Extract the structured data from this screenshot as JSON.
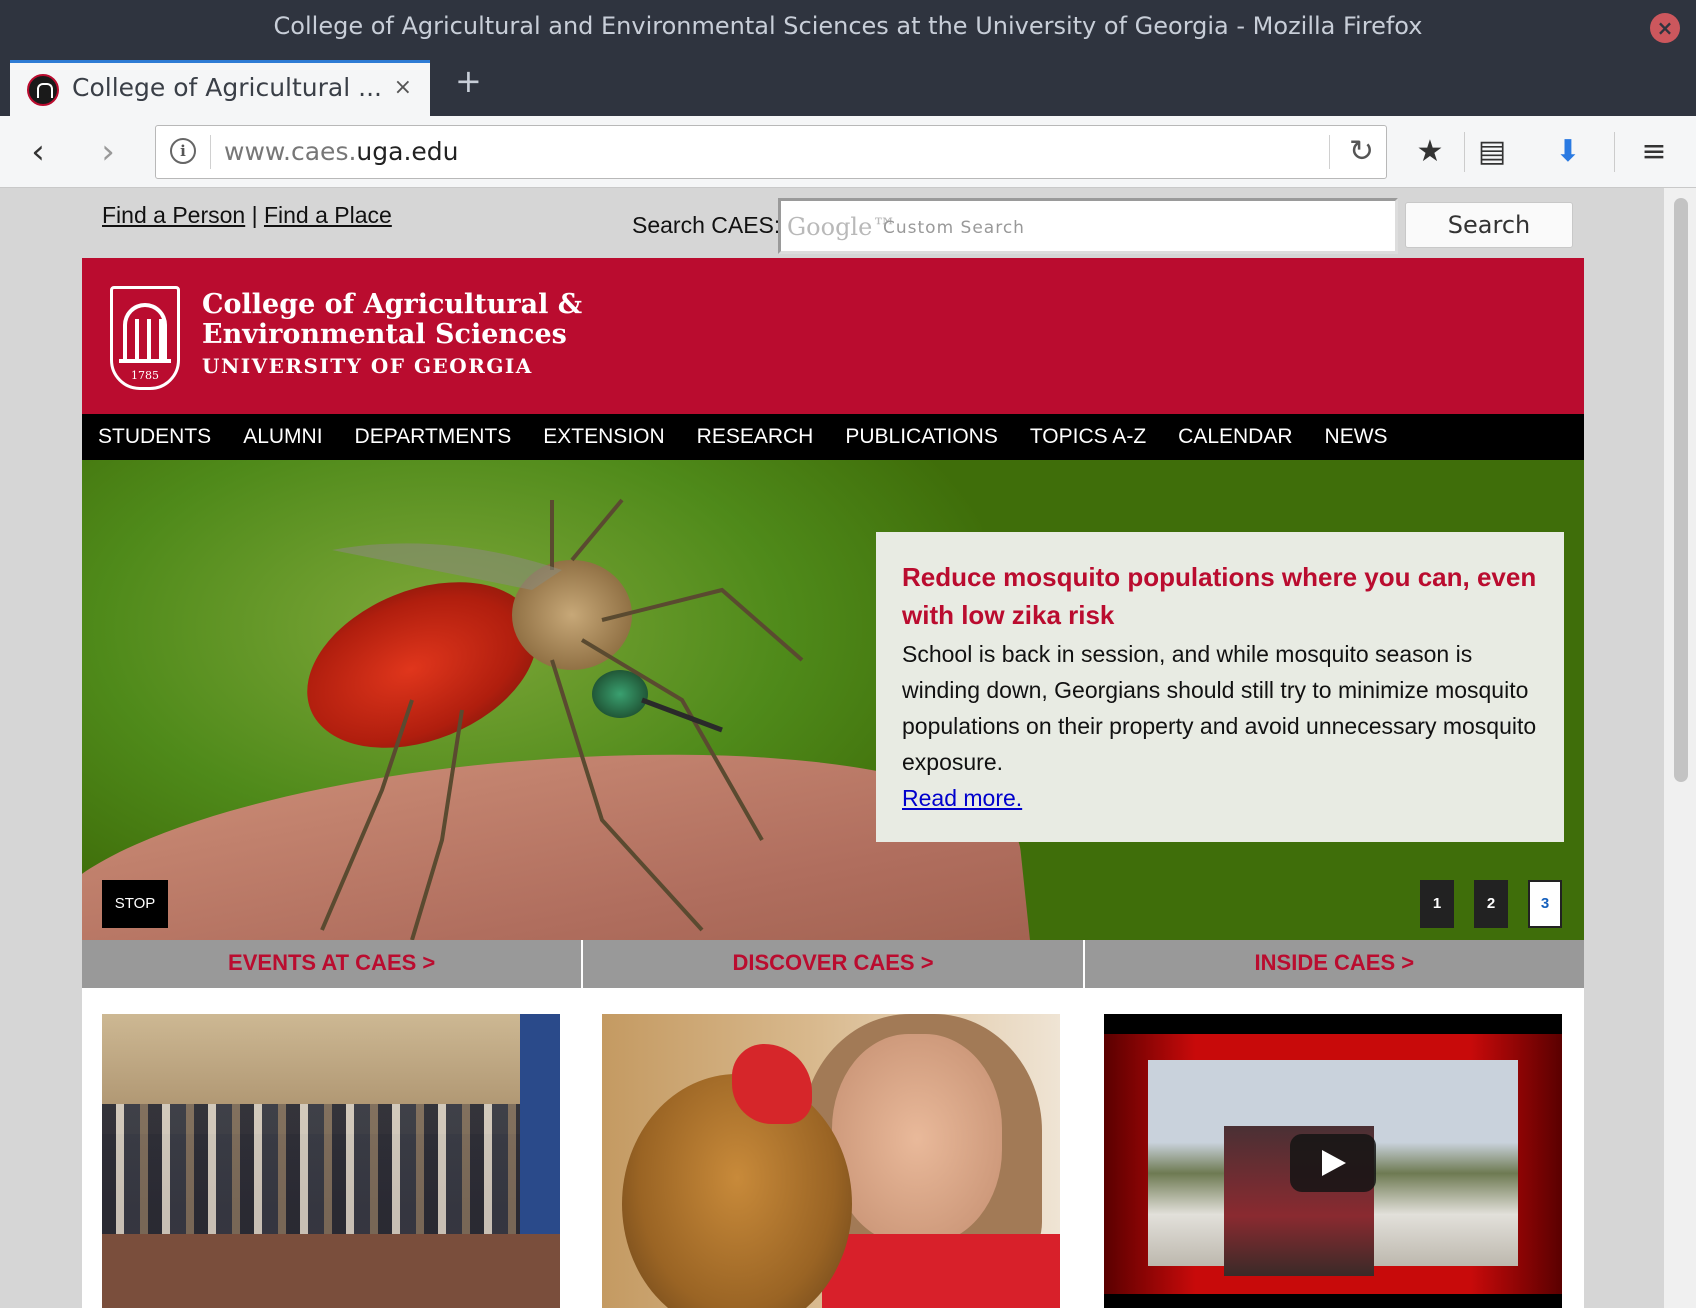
{
  "window": {
    "title": "College of Agricultural and Environmental Sciences at the University of Georgia - Mozilla Firefox"
  },
  "tab": {
    "title": "College of Agricultural ...",
    "close": "×",
    "new_tab": "+"
  },
  "urlbar": {
    "url_prefix": "www.caes.",
    "url_domain": "uga.edu"
  },
  "utility": {
    "find_person": "Find a Person",
    "separator": "|",
    "find_place": "Find a Place"
  },
  "search": {
    "label": "Search CAES:",
    "google": "Google™",
    "placeholder": "Custom Search",
    "button": "Search"
  },
  "header": {
    "name_line1": "College of Agricultural &",
    "name_line2": "Environmental Sciences",
    "university": "UNIVERSITY OF GEORGIA",
    "year": "1785"
  },
  "nav": [
    "STUDENTS",
    "ALUMNI",
    "DEPARTMENTS",
    "EXTENSION",
    "RESEARCH",
    "PUBLICATIONS",
    "TOPICS A-Z",
    "CALENDAR",
    "NEWS"
  ],
  "hero": {
    "title": "Reduce mosquito populations where you can, even with low zika risk",
    "body": "School is back in session, and while mosquito season is winding down, Georgians should still try to minimize mosquito populations on their property and avoid unnecessary mosquito exposure.",
    "link": "Read more.",
    "stop": "STOP",
    "pages": [
      "1",
      "2",
      "3"
    ],
    "active_page": "3"
  },
  "feature_tabs": [
    "EVENTS AT CAES >",
    "DISCOVER CAES >",
    "INSIDE CAES >"
  ],
  "colors": {
    "brand_red": "#ba0c2f",
    "nav_black": "#000000",
    "hero_green": "#3f6e0a"
  }
}
